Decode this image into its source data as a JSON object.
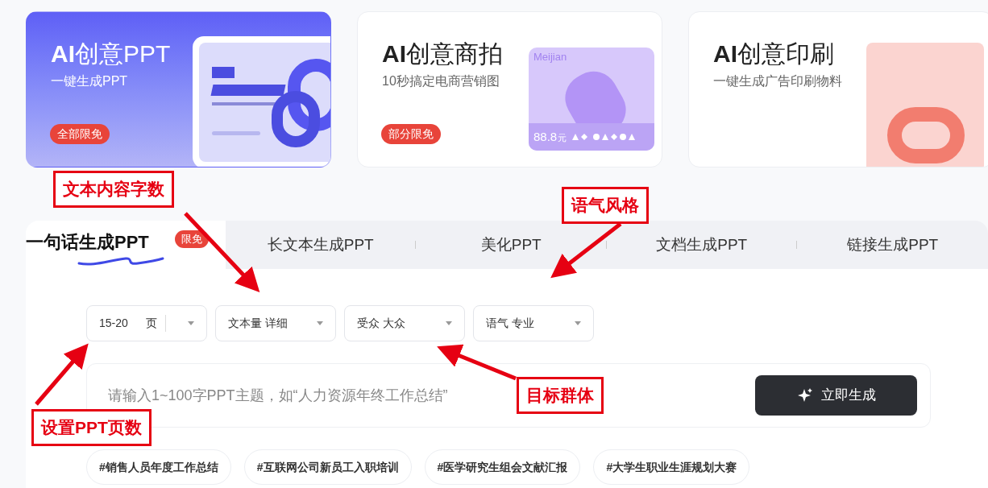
{
  "cards": [
    {
      "title": "**AI**创意PPT",
      "subtitle": "一键生成PPT",
      "badge": "全部限免",
      "kind": "ppt",
      "selected": true
    },
    {
      "title": "**AI**创意商拍",
      "subtitle": "10秒搞定电商营销图",
      "badge": "部分限免",
      "kind": "photo",
      "selected": false,
      "art_label": "Meijian",
      "price": "88.8",
      "unit": "元"
    },
    {
      "title": "**AI**创意印刷",
      "subtitle": "一键生成广告印刷物料",
      "kind": "print",
      "selected": false
    }
  ],
  "tabs": [
    {
      "label": "一句话生成PPT",
      "badge": "限免",
      "selected": true
    },
    {
      "label": "长文本生成PPT",
      "selected": false
    },
    {
      "label": "美化PPT",
      "selected": false
    },
    {
      "label": "文档生成PPT",
      "selected": false
    },
    {
      "label": "链接生成PPT",
      "selected": false
    }
  ],
  "filters": [
    {
      "value": "15-20",
      "unit": "页"
    },
    {
      "value": "文本量 详细"
    },
    {
      "value": "受众 大众"
    },
    {
      "value": "语气 专业"
    }
  ],
  "prompt": {
    "placeholder": "请输入1~100字PPT主题，如“人力资源年终工作总结”",
    "button": "立即生成"
  },
  "suggestions": [
    "#销售人员年度工作总结",
    "#互联网公司新员工入职培训",
    "#医学研究生组会文献汇报",
    "#大学生职业生涯规划大赛"
  ],
  "annotations": [
    {
      "text": "文本内容字数",
      "kind": "top-left"
    },
    {
      "text": "语气风格",
      "kind": "top-right"
    },
    {
      "text": "目标群体",
      "kind": "mid"
    },
    {
      "text": "设置PPT页数",
      "kind": "bottom-left"
    }
  ]
}
